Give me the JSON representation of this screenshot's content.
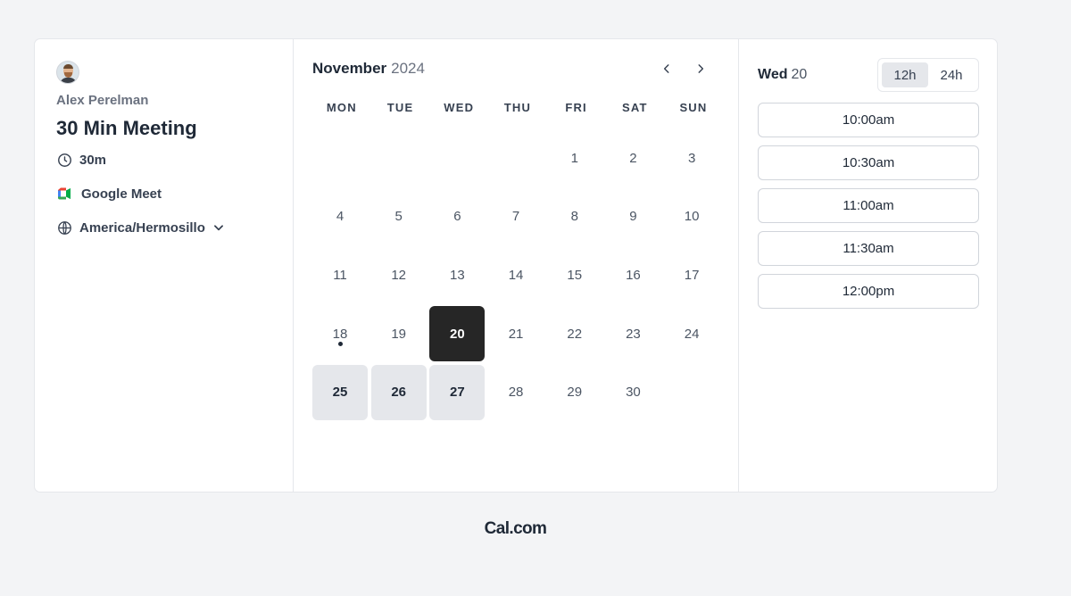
{
  "host": {
    "name": "Alex Perelman"
  },
  "event": {
    "title": "30 Min Meeting",
    "duration": "30m",
    "location": "Google Meet",
    "timezone": "America/Hermosillo"
  },
  "calendar": {
    "month": "November",
    "year": "2024",
    "weekdays": [
      "MON",
      "TUE",
      "WED",
      "THU",
      "FRI",
      "SAT",
      "SUN"
    ],
    "days": [
      {
        "label": ""
      },
      {
        "label": ""
      },
      {
        "label": ""
      },
      {
        "label": ""
      },
      {
        "label": "1"
      },
      {
        "label": "2"
      },
      {
        "label": "3"
      },
      {
        "label": "4"
      },
      {
        "label": "5"
      },
      {
        "label": "6"
      },
      {
        "label": "7"
      },
      {
        "label": "8"
      },
      {
        "label": "9"
      },
      {
        "label": "10"
      },
      {
        "label": "11"
      },
      {
        "label": "12"
      },
      {
        "label": "13"
      },
      {
        "label": "14"
      },
      {
        "label": "15"
      },
      {
        "label": "16"
      },
      {
        "label": "17"
      },
      {
        "label": "18",
        "today": true
      },
      {
        "label": "19"
      },
      {
        "label": "20",
        "state": "selected"
      },
      {
        "label": "21"
      },
      {
        "label": "22"
      },
      {
        "label": "23"
      },
      {
        "label": "24"
      },
      {
        "label": "25",
        "state": "available"
      },
      {
        "label": "26",
        "state": "available"
      },
      {
        "label": "27",
        "state": "available"
      },
      {
        "label": "28"
      },
      {
        "label": "29"
      },
      {
        "label": "30"
      }
    ]
  },
  "slots": {
    "day_name": "Wed",
    "day_number": "20",
    "format_options": [
      "12h",
      "24h"
    ],
    "active_format": "12h",
    "times": [
      "10:00am",
      "10:30am",
      "11:00am",
      "11:30am",
      "12:00pm"
    ]
  },
  "brand": "Cal.com",
  "colors": {
    "selected_day": "#262626",
    "available_day": "#e5e7eb",
    "background": "#f3f4f6"
  },
  "icons": {
    "duration": "clock-icon",
    "location": "google-meet-icon",
    "timezone": "globe-icon",
    "timezone_menu": "chevron-down-icon",
    "prev_month": "chevron-left-icon",
    "next_month": "chevron-right-icon"
  }
}
